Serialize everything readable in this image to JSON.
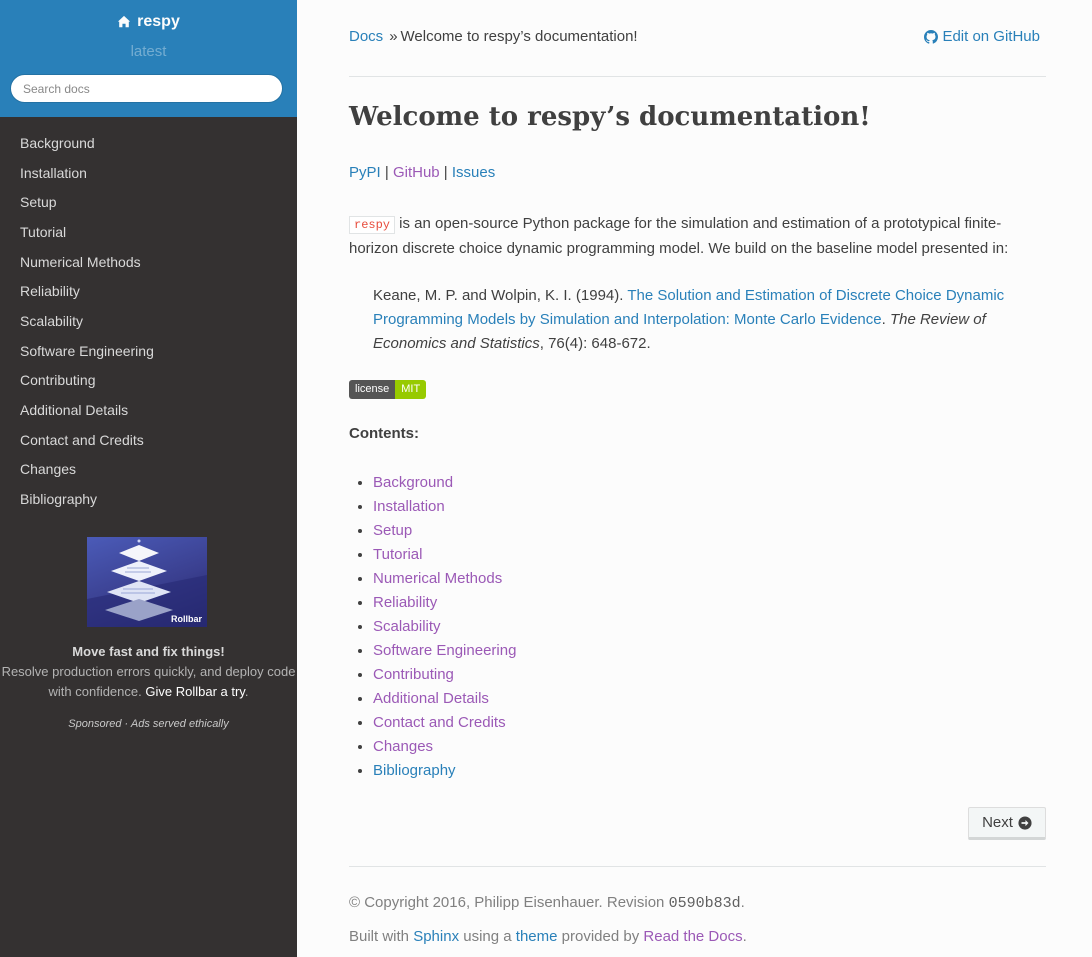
{
  "sidebar": {
    "project": "respy",
    "version": "latest",
    "search_placeholder": "Search docs",
    "items": [
      {
        "label": "Background"
      },
      {
        "label": "Installation"
      },
      {
        "label": "Setup"
      },
      {
        "label": "Tutorial"
      },
      {
        "label": "Numerical Methods"
      },
      {
        "label": "Reliability"
      },
      {
        "label": "Scalability"
      },
      {
        "label": "Software Engineering"
      },
      {
        "label": "Contributing"
      },
      {
        "label": "Additional Details"
      },
      {
        "label": "Contact and Credits"
      },
      {
        "label": "Changes"
      },
      {
        "label": "Bibliography"
      }
    ],
    "ad": {
      "brand": "Rollbar",
      "headline": "Move fast and fix things!",
      "body": "Resolve production errors quickly, and deploy code with confidence.",
      "cta": "Give Rollbar a try",
      "cta_suffix": ".",
      "sponsor": "Sponsored · Ads served ethically"
    }
  },
  "breadcrumb": {
    "home": "Docs",
    "separator": "»",
    "current": "Welcome to respy’s documentation!",
    "edit": "Edit on GitHub"
  },
  "main": {
    "title": "Welcome to respy’s documentation!",
    "links": [
      "PyPI",
      "GitHub",
      "Issues"
    ],
    "link_separator": "|",
    "intro_code": "respy",
    "intro_text": " is an open-source Python package for the simulation and estimation of a prototypical finite-horizon discrete choice dynamic programming model. We build on the baseline model presented in:",
    "quote_authors": "Keane, M. P. and Wolpin, K. I. (1994). ",
    "quote_link": "The Solution and Estimation of Discrete Choice Dynamic Programming Models by Simulation and Interpolation: Monte Carlo Evidence",
    "quote_period": ". ",
    "quote_journal": "The Review of Economics and Statistics",
    "quote_rest": ", 76(4): 648-672.",
    "badge_left": "license",
    "badge_right": "MIT",
    "contents_label": "Contents:",
    "toc": [
      "Background",
      "Installation",
      "Setup",
      "Tutorial",
      "Numerical Methods",
      "Reliability",
      "Scalability",
      "Software Engineering",
      "Contributing",
      "Additional Details",
      "Contact and Credits",
      "Changes",
      "Bibliography"
    ],
    "next": "Next"
  },
  "footer": {
    "copyright": "© Copyright 2016, Philipp Eisenhauer. Revision ",
    "revision": "0590b83d",
    "copyright_end": ".",
    "built_with": "Built with ",
    "sphinx": "Sphinx",
    "using_a": " using a ",
    "theme": "theme",
    "provided_by": " provided by ",
    "rtd": "Read the Docs",
    "end": "."
  },
  "colors": {
    "accent": "#2980b9",
    "visited": "#9b59b6",
    "sidebar_bg": "#343131",
    "badge_green": "#97ca00"
  }
}
